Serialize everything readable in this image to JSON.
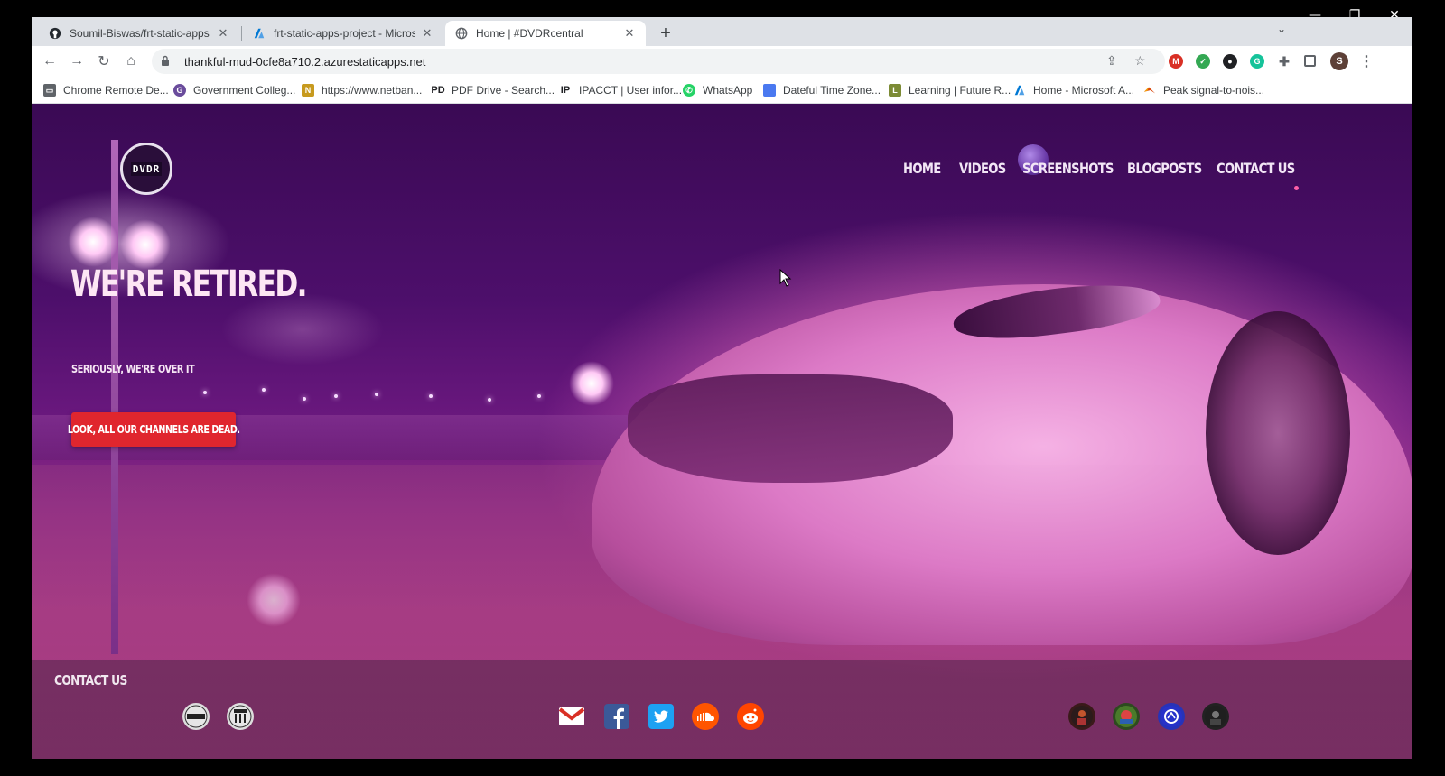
{
  "window_controls": {
    "minimize": "—",
    "restore": "❐",
    "close": "✕"
  },
  "tabs": [
    {
      "title": "Soumil-Biswas/frt-static-apps: A",
      "icon": "github-icon",
      "active": false
    },
    {
      "title": "frt-static-apps-project - Microso",
      "icon": "azure-icon",
      "active": false
    },
    {
      "title": "Home | #DVDRcentral",
      "icon": "globe-icon",
      "active": true
    }
  ],
  "tab_close_glyph": "✕",
  "new_tab_glyph": "+",
  "tab_menu_glyph": "⌄",
  "toolbar": {
    "back": "←",
    "forward": "→",
    "reload": "↻",
    "home": "⌂",
    "url": "thankful-mud-0cfe8a710.2.azurestaticapps.net",
    "lock": "🔒",
    "share": "⇪",
    "star": "☆",
    "menu": "⋮",
    "profile": "S"
  },
  "bookmarks": [
    {
      "label": "Chrome Remote De...",
      "icon": "remote-desktop-icon",
      "color": "#5f6368"
    },
    {
      "label": "Government Colleg...",
      "icon": "college-icon",
      "color": "#6a4c9c"
    },
    {
      "label": "https://www.netban...",
      "icon": "netbanking-icon",
      "color": "#c79a1e"
    },
    {
      "label": "PDF Drive - Search...",
      "icon": "pdf-drive-icon",
      "color": "#202124"
    },
    {
      "label": "IPACCT | User infor...",
      "icon": "ipacct-icon",
      "color": "#202124"
    },
    {
      "label": "WhatsApp",
      "icon": "whatsapp-icon",
      "color": "#25d366"
    },
    {
      "label": "Dateful Time Zone...",
      "icon": "calendar-icon",
      "color": "#4a79f0"
    },
    {
      "label": "Learning | Future R...",
      "icon": "learning-icon",
      "color": "#7c8b35"
    },
    {
      "label": "Home - Microsoft A...",
      "icon": "azure-icon",
      "color": "#0078d4"
    },
    {
      "label": "Peak signal-to-nois...",
      "icon": "matlab-icon",
      "color": "#d9480f"
    }
  ],
  "site": {
    "logo_text": "DVDR",
    "nav": [
      "HOME",
      "VIDEOS",
      "SCREENSHOTS",
      "BLOGPOSTS",
      "CONTACT US"
    ],
    "hero_title": "WE'RE RETIRED.",
    "hero_subtitle": "SERIOUSLY, WE'RE OVER IT",
    "hero_button": "LOOK, ALL OUR CHANNELS ARE DEAD.",
    "footer_title": "CONTACT US"
  },
  "footer_icons": {
    "left": [
      "dvdr-logo-icon",
      "dvdr-alt-logo-icon"
    ],
    "center": [
      "gmail-icon",
      "facebook-icon",
      "twitter-icon",
      "soundcloud-icon",
      "reddit-icon"
    ],
    "right": [
      "member-avatar-1-icon",
      "member-avatar-2-icon",
      "member-avatar-3-icon",
      "member-avatar-4-icon"
    ]
  },
  "colors": {
    "accent_button": "#e0262e",
    "page_purple": "#4d0f6b",
    "car_pink": "#de7cc8"
  }
}
